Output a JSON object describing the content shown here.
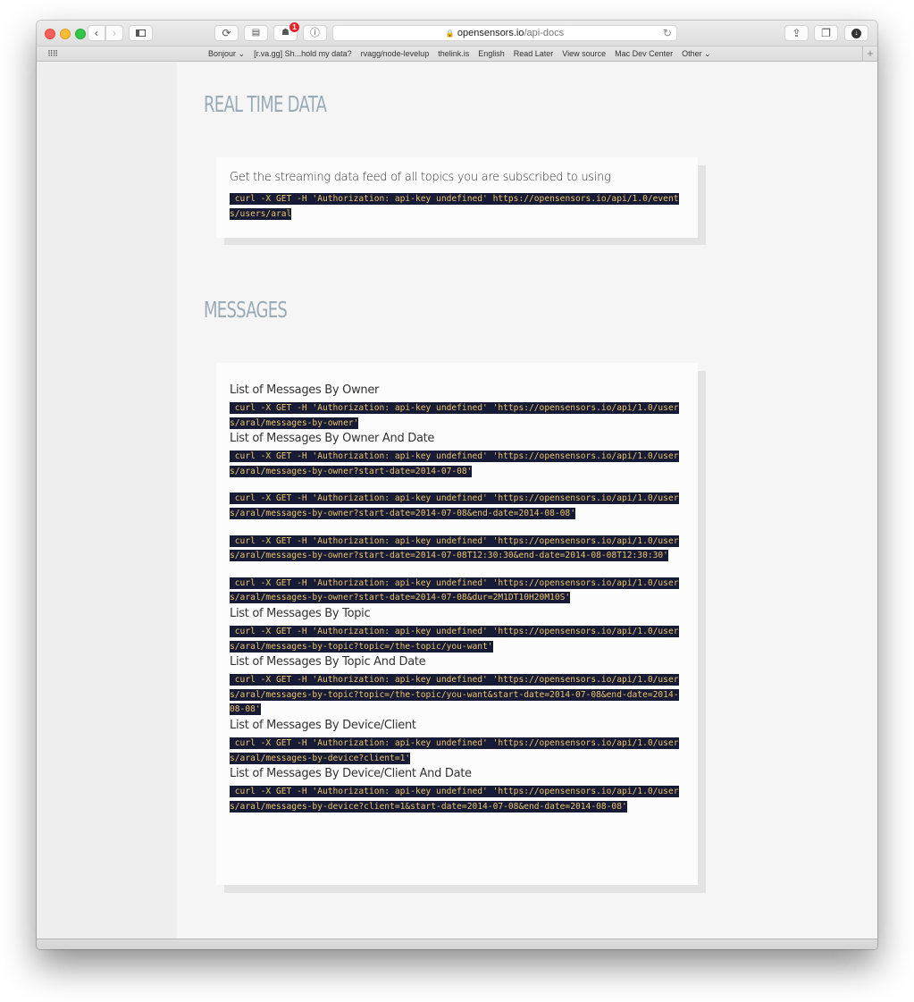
{
  "browser": {
    "url_domain": "opensensors.io",
    "url_path": "/api-docs",
    "extension_badge_count": "1",
    "icons": {
      "back": "chevron-left-icon",
      "forward": "chevron-right-icon",
      "sidebar": "sidebar-icon",
      "share": "share-icon",
      "tabs": "tabs-overview-icon",
      "downloads": "download-icon",
      "reload": "reload-icon",
      "lock": "lock-icon"
    },
    "bookmarks": [
      "Bonjour ⌄",
      "[r.va.gg] Sh...hold my data?",
      "rvagg/node-levelup",
      "thelink.is",
      "English",
      "Read Later",
      "View source",
      "Mac Dev Center",
      "Other ⌄"
    ]
  },
  "page": {
    "realtime": {
      "title": "REAL TIME DATA",
      "description": "Get the streaming data feed of all topics you are subscribed to using",
      "command": " curl -X GET -H 'Authorization: api-key undefined' https://opensensors.io/api/1.0/events/users/aral"
    },
    "messages": {
      "title": "MESSAGES",
      "endpoints": [
        {
          "label": "List of Messages By Owner",
          "commands": [
            " curl -X GET -H 'Authorization: api-key undefined' 'https://opensensors.io/api/1.0/users/aral/messages-by-owner'"
          ]
        },
        {
          "label": "List of Messages By Owner And Date",
          "commands": [
            " curl -X GET -H 'Authorization: api-key undefined' 'https://opensensors.io/api/1.0/users/aral/messages-by-owner?start-date=2014-07-08'",
            " curl -X GET -H 'Authorization: api-key undefined' 'https://opensensors.io/api/1.0/users/aral/messages-by-owner?start-date=2014-07-08&end-date=2014-08-08'",
            " curl -X GET -H 'Authorization: api-key undefined' 'https://opensensors.io/api/1.0/users/aral/messages-by-owner?start-date=2014-07-08T12:30:30&end-date=2014-08-08T12:30:30'",
            " curl -X GET -H 'Authorization: api-key undefined' 'https://opensensors.io/api/1.0/users/aral/messages-by-owner?start-date=2014-07-08&dur=2M1DT10H20M10S'"
          ]
        },
        {
          "label": "List of Messages By Topic",
          "commands": [
            " curl -X GET -H 'Authorization: api-key undefined' 'https://opensensors.io/api/1.0/users/aral/messages-by-topic?topic=/the-topic/you-want'"
          ]
        },
        {
          "label": "List of Messages By Topic And Date",
          "commands": [
            " curl -X GET -H 'Authorization: api-key undefined' 'https://opensensors.io/api/1.0/users/aral/messages-by-topic?topic=/the-topic/you-want&start-date=2014-07-08&end-date=2014-08-08'"
          ]
        },
        {
          "label": "List of Messages By Device/Client",
          "commands": [
            " curl -X GET -H 'Authorization: api-key undefined' 'https://opensensors.io/api/1.0/users/aral/messages-by-device?client=1'"
          ]
        },
        {
          "label": "List of Messages By Device/Client And Date",
          "commands": [
            " curl -X GET -H 'Authorization: api-key undefined' 'https://opensensors.io/api/1.0/users/aral/messages-by-device?client=1&start-date=2014-07-08&end-date=2014-08-08'"
          ]
        }
      ]
    }
  }
}
